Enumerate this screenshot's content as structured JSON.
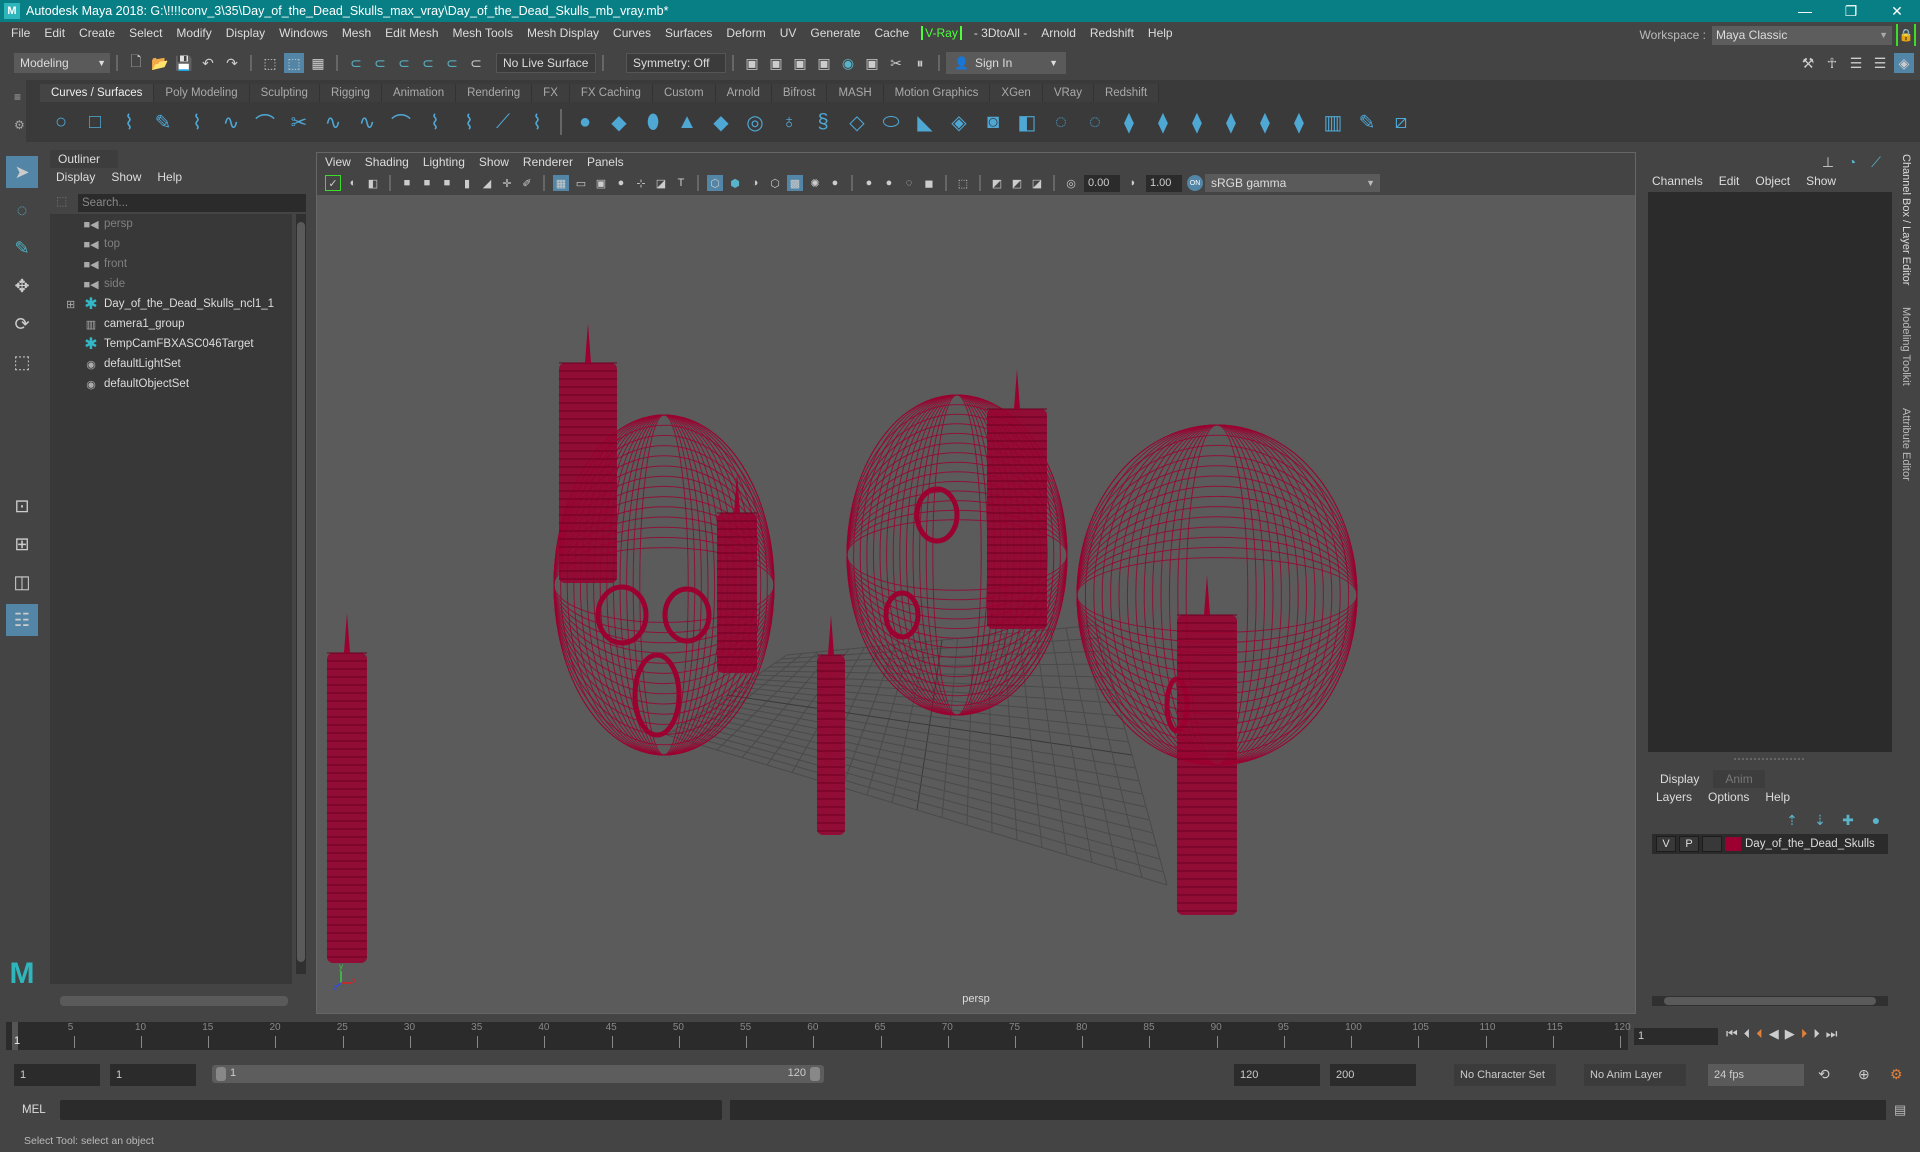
{
  "window": {
    "title": "Autodesk Maya 2018: G:\\!!!!conv_3\\35\\Day_of_the_Dead_Skulls_max_vray\\Day_of_the_Dead_Skulls_mb_vray.mb*",
    "logo_letter": "M",
    "controls": {
      "minimize": "—",
      "restore": "❐",
      "close": "✕"
    }
  },
  "menubar": {
    "items": [
      "File",
      "Edit",
      "Create",
      "Select",
      "Modify",
      "Display",
      "Windows",
      "Mesh",
      "Edit Mesh",
      "Mesh Tools",
      "Mesh Display",
      "Curves",
      "Surfaces",
      "Deform",
      "UV",
      "Generate",
      "Cache"
    ],
    "vray": "V-Ray",
    "items_after": [
      "- 3DtoAll -",
      "Arnold",
      "Redshift",
      "Help"
    ]
  },
  "workspace": {
    "label": "Workspace :",
    "value": "Maya Classic"
  },
  "statusline": {
    "mode": "Modeling",
    "live_surface": "No Live Surface",
    "symmetry": "Symmetry: Off",
    "sign_in": "Sign In"
  },
  "shelf": {
    "tabs": [
      "Curves / Surfaces",
      "Poly Modeling",
      "Sculpting",
      "Rigging",
      "Animation",
      "Rendering",
      "FX",
      "FX Caching",
      "Custom",
      "Arnold",
      "Bifrost",
      "MASH",
      "Motion Graphics",
      "XGen",
      "VRay",
      "Redshift"
    ],
    "active_tab": 0,
    "icons": [
      "nurbs-circle-icon",
      "nurbs-square-icon",
      "cv-curve-icon",
      "pencil-curve-icon",
      "ep-curve-icon",
      "bezier-curve-icon",
      "arc-icon",
      "curve-cut-icon",
      "attach-curves-icon",
      "detach-curves-icon",
      "fillet-icon",
      "rebuild-curve-icon",
      "reverse-curve-icon",
      "extend-curve-icon",
      "offset-curve-icon",
      "nurbs-sphere-icon",
      "nurbs-cube-icon",
      "nurbs-cylinder-icon",
      "nurbs-cone-icon",
      "nurbs-plane-icon",
      "nurbs-torus-icon",
      "revolve-icon",
      "loft-icon",
      "planar-icon",
      "extrude-icon",
      "birail-icon",
      "bevel-icon",
      "boundary-icon",
      "square-surface-icon",
      "project-curve-icon",
      "trim-icon",
      "untrim-icon",
      "attach-surfaces-icon",
      "detach-surfaces-icon",
      "open-close-icon",
      "insert-isoparm-icon",
      "extend-surface-icon",
      "rebuild-surface-icon",
      "sculpt-surface-icon",
      "surface-edit-icon"
    ]
  },
  "outliner": {
    "tab": "Outliner",
    "menu": [
      "Display",
      "Show",
      "Help"
    ],
    "search_placeholder": "Search...",
    "items": [
      {
        "label": "persp",
        "icon": "camera-icon",
        "dim": true
      },
      {
        "label": "top",
        "icon": "camera-icon",
        "dim": true
      },
      {
        "label": "front",
        "icon": "camera-icon",
        "dim": true
      },
      {
        "label": "side",
        "icon": "camera-icon",
        "dim": true
      },
      {
        "label": "Day_of_the_Dead_Skulls_ncl1_1",
        "icon": "transform-icon",
        "expandable": true
      },
      {
        "label": "camera1_group",
        "icon": "group-icon"
      },
      {
        "label": "TempCamFBXASC046Target",
        "icon": "transform-icon"
      },
      {
        "label": "defaultLightSet",
        "icon": "set-icon"
      },
      {
        "label": "defaultObjectSet",
        "icon": "set-icon"
      }
    ]
  },
  "viewport": {
    "menu": [
      "View",
      "Shading",
      "Lighting",
      "Show",
      "Renderer",
      "Panels"
    ],
    "exposure": "0.00",
    "gamma": "1.00",
    "color_mgmt": "ON",
    "color_space": "sRGB gamma",
    "camera": "persp",
    "wire_color": "#9b0030",
    "axis": {
      "x": "x",
      "y": "y",
      "z": "z"
    }
  },
  "channelbox": {
    "menu": [
      "Channels",
      "Edit",
      "Object",
      "Show"
    ]
  },
  "layereditor": {
    "tabs": [
      "Display",
      "Anim"
    ],
    "active_tab": 0,
    "menu": [
      "Layers",
      "Options",
      "Help"
    ],
    "layers": [
      {
        "v": "V",
        "p": "P",
        "name": "Day_of_the_Dead_Skulls",
        "color": "#9b0030"
      }
    ]
  },
  "sidetabs": [
    "Channel Box / Layer Editor",
    "Modeling Toolkit",
    "Attribute Editor"
  ],
  "timeline": {
    "ticks": [
      5,
      10,
      15,
      20,
      25,
      30,
      35,
      40,
      45,
      50,
      55,
      60,
      65,
      70,
      75,
      80,
      85,
      90,
      95,
      100,
      105,
      110,
      115,
      120
    ],
    "min": 1,
    "max": 120,
    "current_frame": "1",
    "frame_field": "1"
  },
  "range": {
    "start": "1",
    "anim_start": "1",
    "slider_start": "1",
    "slider_end": "120",
    "end": "120",
    "anim_end": "200",
    "character_set": "No Character Set",
    "anim_layer": "No Anim Layer",
    "fps": "24 fps"
  },
  "commandline": {
    "label": "MEL"
  },
  "helpline": "Select Tool: select an object"
}
